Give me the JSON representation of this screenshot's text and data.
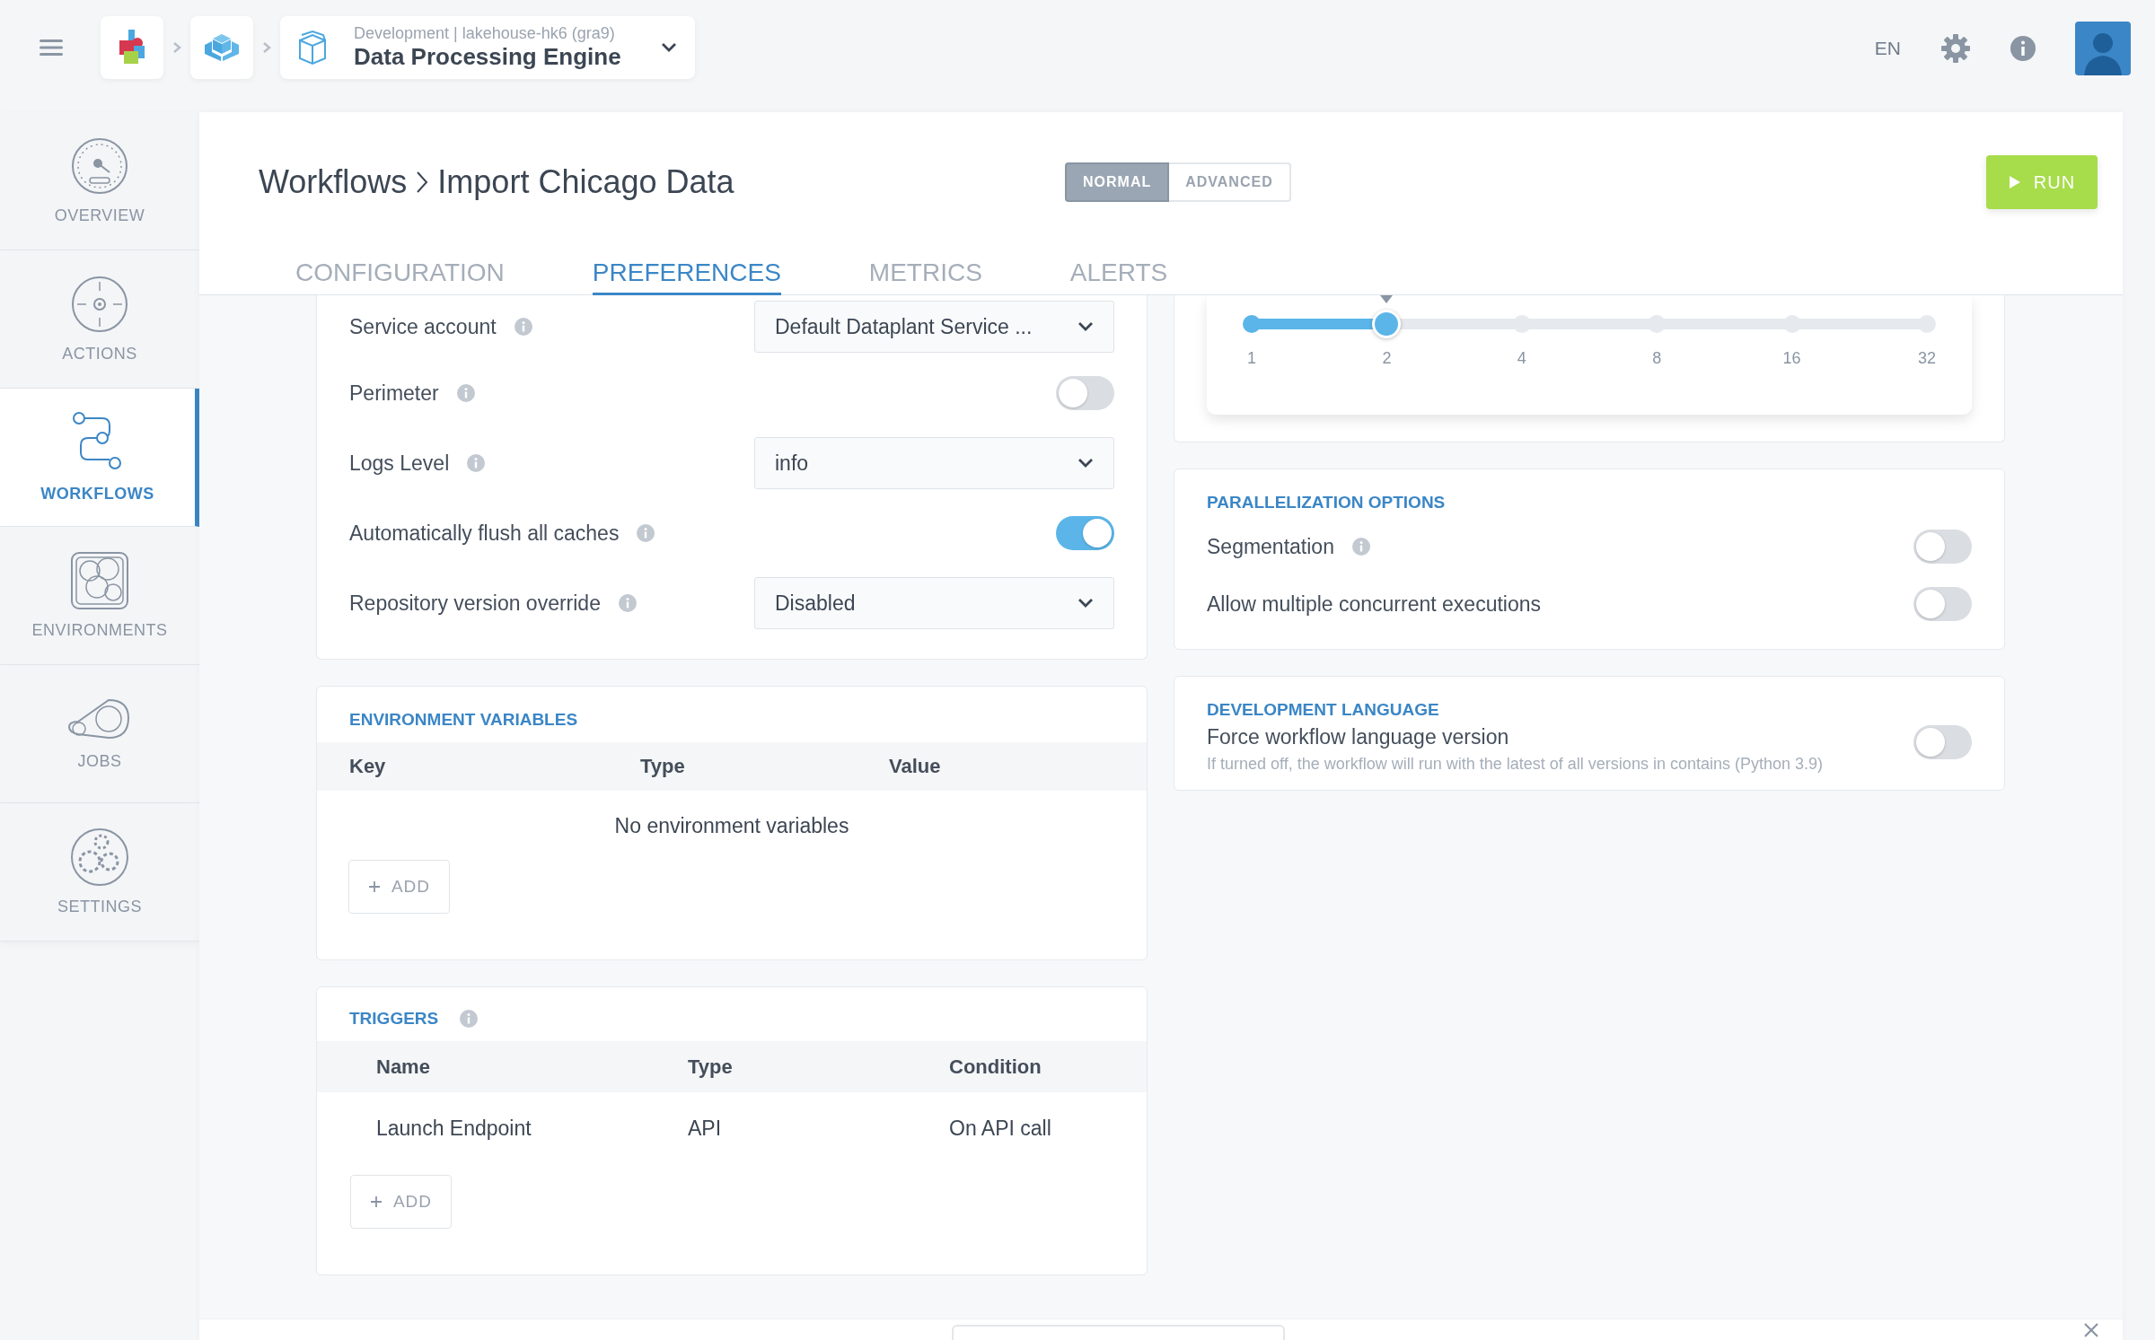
{
  "topbar": {
    "subtitle": "Development | lakehouse-hk6 (gra9)",
    "title": "Data Processing Engine",
    "language": "EN"
  },
  "sidebar": {
    "items": [
      {
        "label": "OVERVIEW",
        "kind": "gauge",
        "selected": false
      },
      {
        "label": "ACTIONS",
        "kind": "target",
        "selected": false
      },
      {
        "label": "WORKFLOWS",
        "kind": "path",
        "selected": true
      },
      {
        "label": "ENVIRONMENTS",
        "kind": "bubbles",
        "selected": false
      },
      {
        "label": "JOBS",
        "kind": "chain",
        "selected": false
      },
      {
        "label": "SETTINGS",
        "kind": "gears",
        "selected": false
      }
    ]
  },
  "header": {
    "breadcrumb": [
      "Workflows",
      "Import Chicago Data"
    ],
    "modes": [
      {
        "label": "NORMAL",
        "selected": true
      },
      {
        "label": "ADVANCED",
        "selected": false
      }
    ],
    "run_button": "RUN"
  },
  "tabs": [
    {
      "label": "CONFIGURATION",
      "selected": false
    },
    {
      "label": "PREFERENCES",
      "selected": true
    },
    {
      "label": "METRICS",
      "selected": false
    },
    {
      "label": "ALERTS",
      "selected": false
    }
  ],
  "settings": {
    "rows": [
      {
        "kind": "select",
        "label": "Service account",
        "info": true,
        "value": "Default Dataplant Service ..."
      },
      {
        "kind": "toggle",
        "label": "Perimeter",
        "info": true,
        "on": false
      },
      {
        "kind": "select",
        "label": "Logs Level",
        "info": true,
        "value": "info"
      },
      {
        "kind": "toggle",
        "label": "Automatically flush all caches",
        "info": true,
        "on": true
      },
      {
        "kind": "select",
        "label": "Repository version override",
        "info": true,
        "value": "Disabled"
      }
    ]
  },
  "environment_variables": {
    "title": "ENVIRONMENT VARIABLES",
    "columns": [
      "Key",
      "Type",
      "Value"
    ],
    "empty_text": "No environment variables",
    "add_button": "ADD"
  },
  "triggers": {
    "title": "TRIGGERS",
    "info": true,
    "columns": [
      "Name",
      "Type",
      "Condition"
    ],
    "rows": [
      [
        "Launch Endpoint",
        "API",
        "On API call"
      ]
    ],
    "add_button": "ADD"
  },
  "scaling": {
    "ticks": [
      "1",
      "2",
      "4",
      "8",
      "16",
      "32"
    ],
    "level": 0.2
  },
  "parallelization": {
    "title": "PARALLELIZATION OPTIONS",
    "rows": [
      {
        "label": "Segmentation",
        "info": true,
        "on": false
      },
      {
        "label": "Allow multiple concurrent executions",
        "info": false,
        "on": false
      }
    ]
  },
  "development_language": {
    "title": "DEVELOPMENT LANGUAGE",
    "rows": [
      {
        "label": "Force workflow language version",
        "info": false,
        "hint": "If turned off, the workflow will run with the latest of all versions in contains (Python 3.9)",
        "on": false
      }
    ]
  }
}
